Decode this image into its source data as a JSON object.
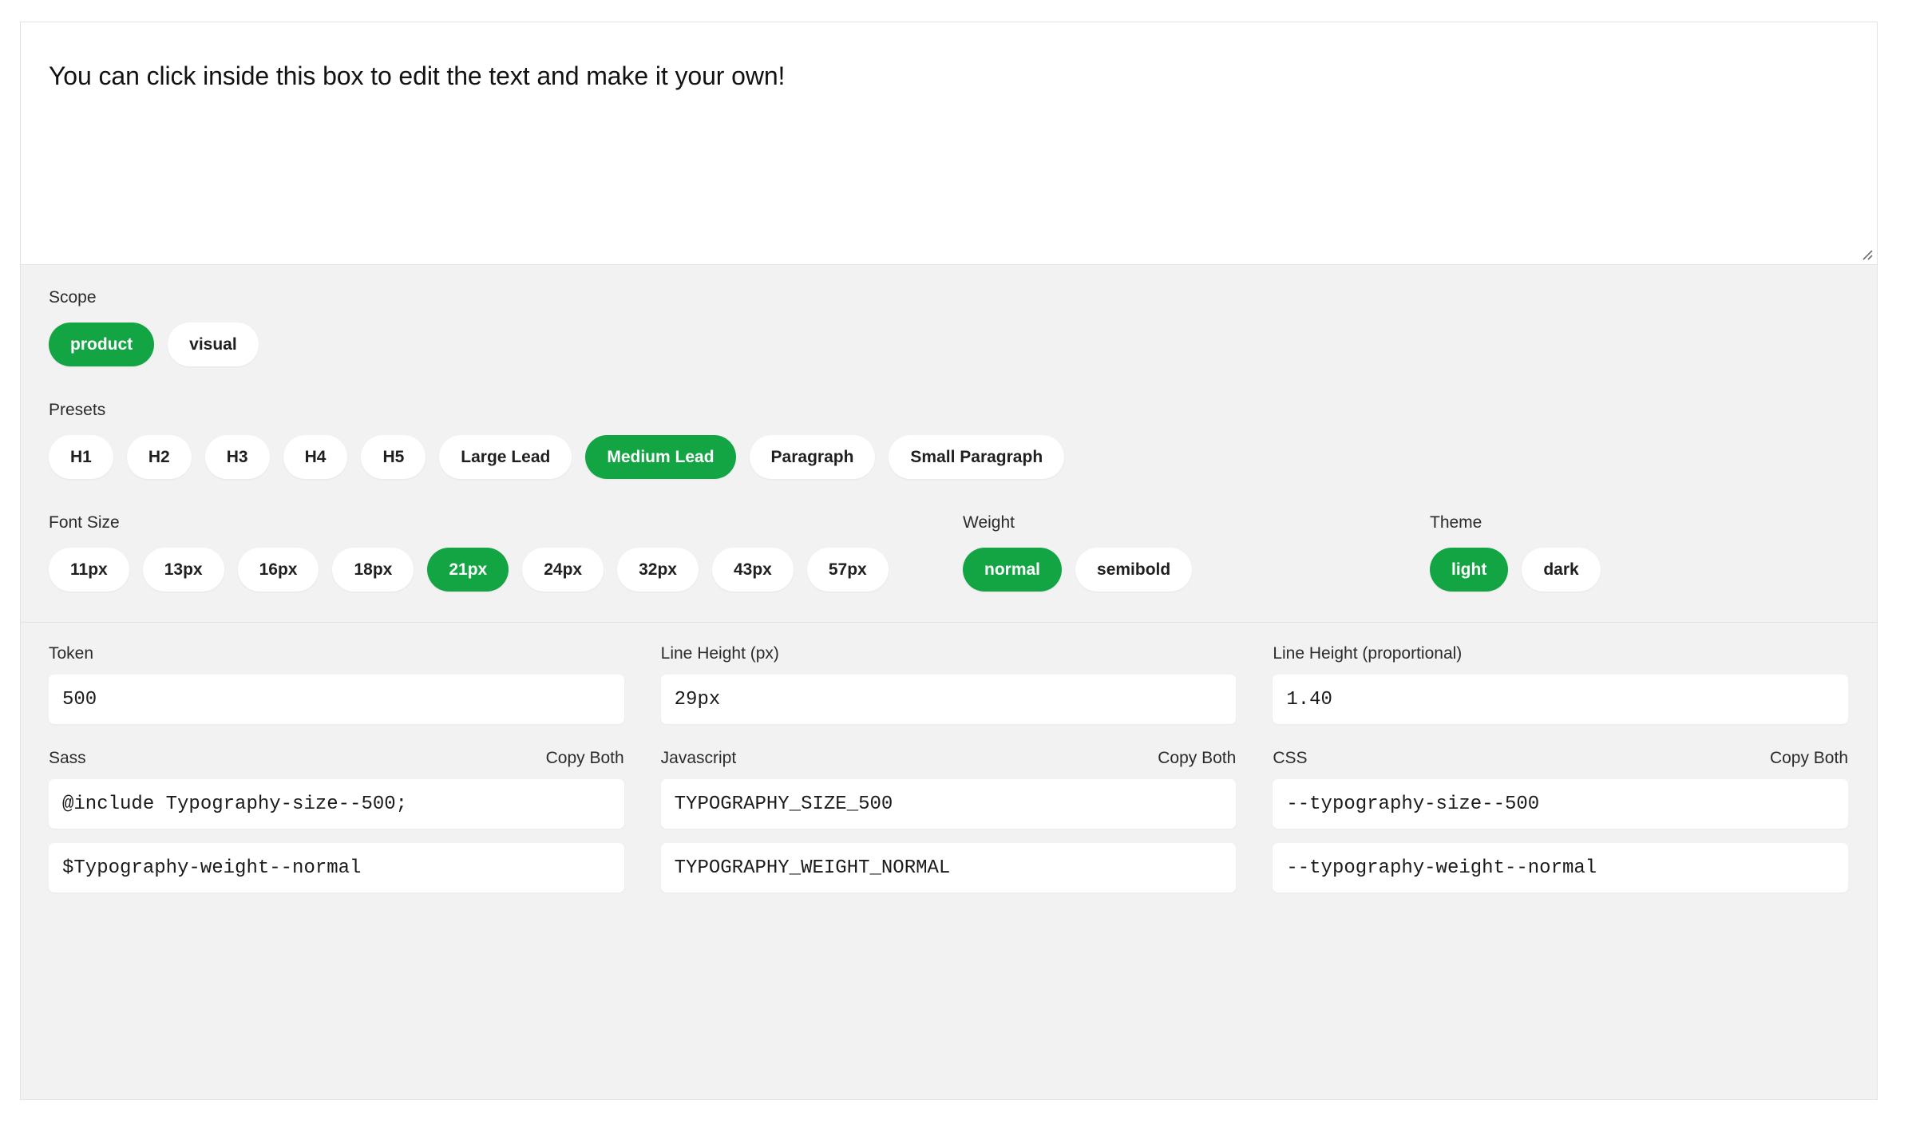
{
  "preview": {
    "text": "You can click inside this box to edit the text and make it your own!",
    "resize_icon": "resize-grip-icon"
  },
  "colors": {
    "accent": "#13a544",
    "panel_bg": "#f2f2f2",
    "surface": "#ffffff",
    "border": "#e2e2e2",
    "text": "#1f1f1f"
  },
  "scope": {
    "label": "Scope",
    "options": [
      {
        "label": "product",
        "selected": true
      },
      {
        "label": "visual",
        "selected": false
      }
    ]
  },
  "presets": {
    "label": "Presets",
    "options": [
      {
        "label": "H1",
        "selected": false
      },
      {
        "label": "H2",
        "selected": false
      },
      {
        "label": "H3",
        "selected": false
      },
      {
        "label": "H4",
        "selected": false
      },
      {
        "label": "H5",
        "selected": false
      },
      {
        "label": "Large Lead",
        "selected": false
      },
      {
        "label": "Medium Lead",
        "selected": true
      },
      {
        "label": "Paragraph",
        "selected": false
      },
      {
        "label": "Small Paragraph",
        "selected": false
      }
    ]
  },
  "font_size": {
    "label": "Font Size",
    "options": [
      {
        "label": "11px",
        "selected": false
      },
      {
        "label": "13px",
        "selected": false
      },
      {
        "label": "16px",
        "selected": false
      },
      {
        "label": "18px",
        "selected": false
      },
      {
        "label": "21px",
        "selected": true
      },
      {
        "label": "24px",
        "selected": false
      },
      {
        "label": "32px",
        "selected": false
      },
      {
        "label": "43px",
        "selected": false
      },
      {
        "label": "57px",
        "selected": false
      }
    ]
  },
  "weight": {
    "label": "Weight",
    "options": [
      {
        "label": "normal",
        "selected": true
      },
      {
        "label": "semibold",
        "selected": false
      }
    ]
  },
  "theme": {
    "label": "Theme",
    "options": [
      {
        "label": "light",
        "selected": true
      },
      {
        "label": "dark",
        "selected": false
      }
    ]
  },
  "tokens": {
    "token": {
      "label": "Token",
      "value": "500"
    },
    "line_height_px": {
      "label": "Line Height (px)",
      "value": "29px"
    },
    "line_height_proportional": {
      "label": "Line Height (proportional)",
      "value": "1.40"
    },
    "copy_both_label": "Copy Both",
    "sass": {
      "label": "Sass",
      "size_value": "@include Typography-size--500;",
      "weight_value": "$Typography-weight--normal"
    },
    "javascript": {
      "label": "Javascript",
      "size_value": "TYPOGRAPHY_SIZE_500",
      "weight_value": "TYPOGRAPHY_WEIGHT_NORMAL"
    },
    "css": {
      "label": "CSS",
      "size_value": "--typography-size--500",
      "weight_value": "--typography-weight--normal"
    }
  }
}
